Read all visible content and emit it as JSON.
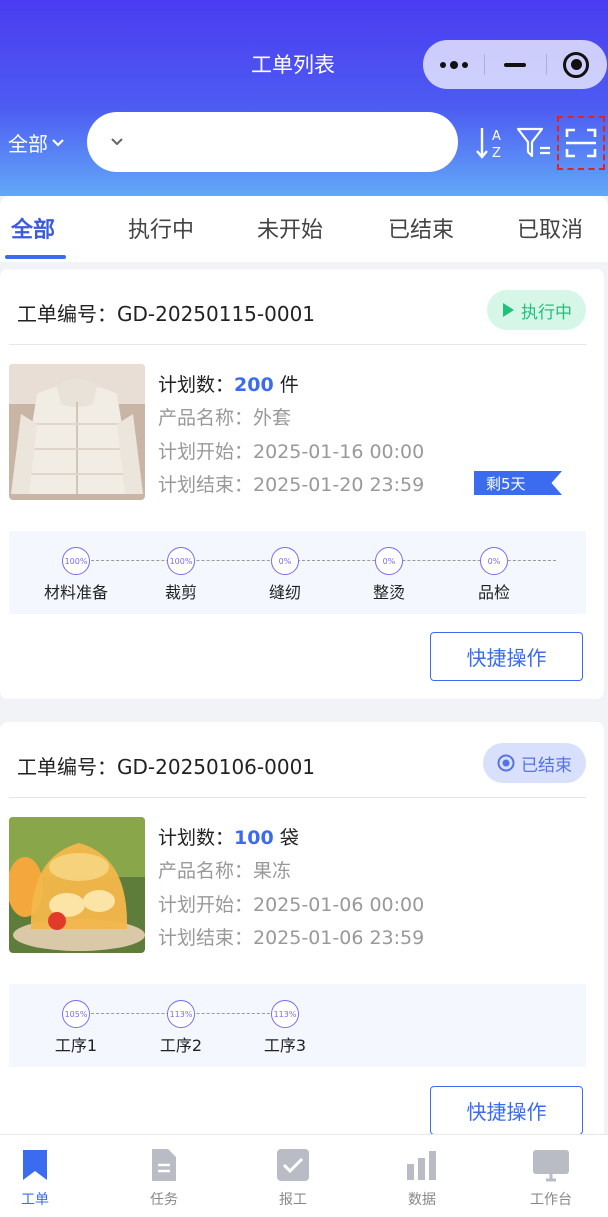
{
  "nav": {
    "title": "工单列表"
  },
  "search": {
    "scope": "全部",
    "placeholder": "",
    "value": ""
  },
  "tabs": [
    {
      "label": "全部",
      "active": true
    },
    {
      "label": "执行中"
    },
    {
      "label": "未开始"
    },
    {
      "label": "已结束"
    },
    {
      "label": "已取消"
    }
  ],
  "orders": [
    {
      "order_no": "工单编号：GD-20250115-0001",
      "status": "执行中",
      "plan_qty_label": "计划数：",
      "plan_qty": "200",
      "unit": "件",
      "product": "产品名称：外套",
      "plan_start": "计划开始：2025-01-16 00:00",
      "plan_end": "计划结束：2025-01-20 23:59",
      "remaining": "剩5天",
      "steps": [
        {
          "label": "材料准备",
          "pct": "100%"
        },
        {
          "label": "裁剪",
          "pct": "100%"
        },
        {
          "label": "缝纫",
          "pct": "0%"
        },
        {
          "label": "整烫",
          "pct": "0%"
        },
        {
          "label": "品检",
          "pct": "0%"
        }
      ],
      "quick_action": "快捷操作"
    },
    {
      "order_no": "工单编号：GD-20250106-0001",
      "status": "已结束",
      "plan_qty_label": "计划数：",
      "plan_qty": "100",
      "unit": "袋",
      "product": "产品名称：果冻",
      "plan_start": "计划开始：2025-01-06 00:00",
      "plan_end": "计划结束：2025-01-06 23:59",
      "steps": [
        {
          "label": "工序1",
          "pct": "105%"
        },
        {
          "label": "工序2",
          "pct": "113%"
        },
        {
          "label": "工序3",
          "pct": "113%"
        }
      ],
      "quick_action": "快捷操作"
    }
  ],
  "bottom_nav": [
    {
      "label": "工单",
      "icon": "bookmark-icon",
      "active": true
    },
    {
      "label": "任务",
      "icon": "document-icon"
    },
    {
      "label": "报工",
      "icon": "check-icon"
    },
    {
      "label": "数据",
      "icon": "bar-chart-icon"
    },
    {
      "label": "工作台",
      "icon": "monitor-icon"
    }
  ],
  "colors": {
    "primary": "#3b6cf0",
    "running": "#22c17a",
    "header_top": "#4a3cf0",
    "header_bottom": "#62a8f8"
  }
}
